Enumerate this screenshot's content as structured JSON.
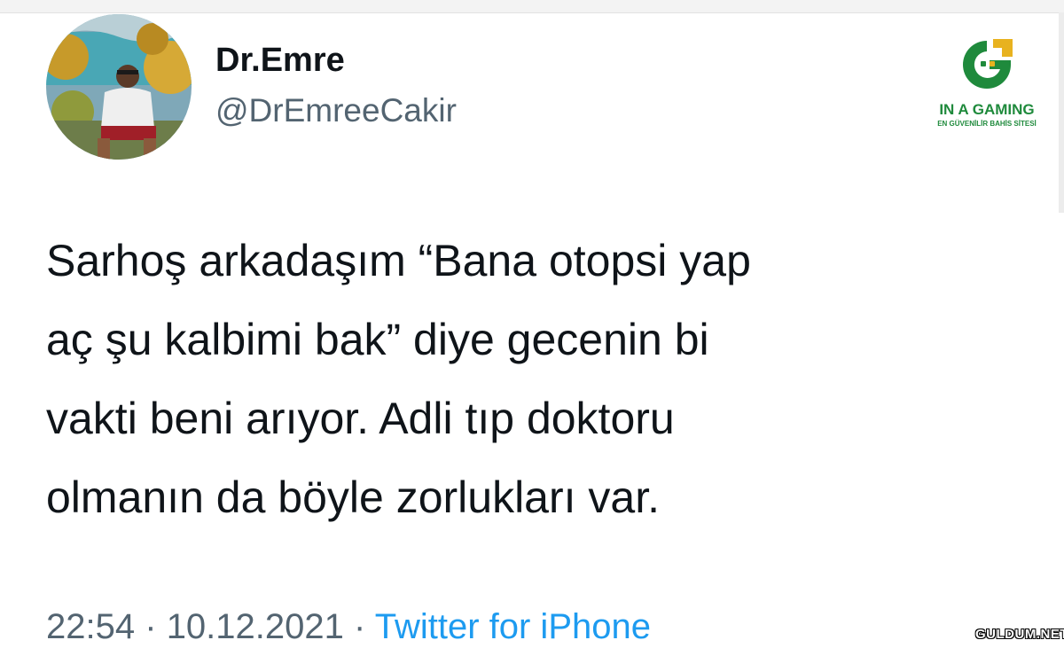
{
  "profile": {
    "display_name": "Dr.Emre",
    "handle": "@DrEmreeCakir"
  },
  "tweet": {
    "lines": [
      "Sarhoş arkadaşım “Bana otopsi yap",
      "aç şu kalbimi bak” diye gecenin bi",
      "vakti beni arıyor. Adli tıp doktoru",
      "olmanın da böyle zorlukları var."
    ],
    "time": "22:54",
    "separator": "·",
    "date": "10.12.2021",
    "source": "Twitter for iPhone"
  },
  "logo": {
    "name": "IN A GAMING",
    "tagline": "EN GÜVENİLİR BAHİS SİTESİ"
  },
  "watermark": "GULDUM.NET",
  "colors": {
    "text": "#0f1419",
    "secondary": "#536471",
    "link": "#1d9bf0",
    "logo_green": "#1f8a3c",
    "logo_gold": "#e8b21f"
  }
}
